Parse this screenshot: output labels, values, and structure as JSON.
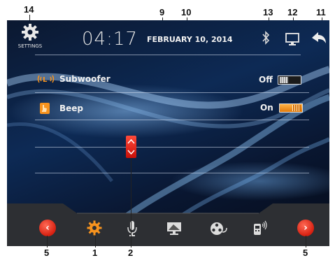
{
  "topbar": {
    "settings_label": "SETTINGS",
    "time": "04:17",
    "date": "FEBRUARY 10, 2014"
  },
  "rows": [
    {
      "label": "Subwoofer",
      "state": "Off",
      "icon": "subwoofer-icon"
    },
    {
      "label": "Beep",
      "state": "On",
      "icon": "beep-icon"
    }
  ],
  "dock": {
    "icons": [
      "settings-gear-icon",
      "microphone-icon",
      "monitor-icon",
      "film-reel-icon",
      "phone-signal-icon"
    ],
    "left_arrow": "‹",
    "right_arrow": "›"
  },
  "callouts": {
    "c14": "14",
    "c9": "9",
    "c10": "10",
    "c13": "13",
    "c12": "12",
    "c11": "11",
    "c5_left": "5",
    "c1": "1",
    "c2": "2",
    "c5_right": "5"
  },
  "colors": {
    "accent": "#f7931e",
    "nav_red": "#d61f10",
    "screen_bg": "#0b1830"
  }
}
